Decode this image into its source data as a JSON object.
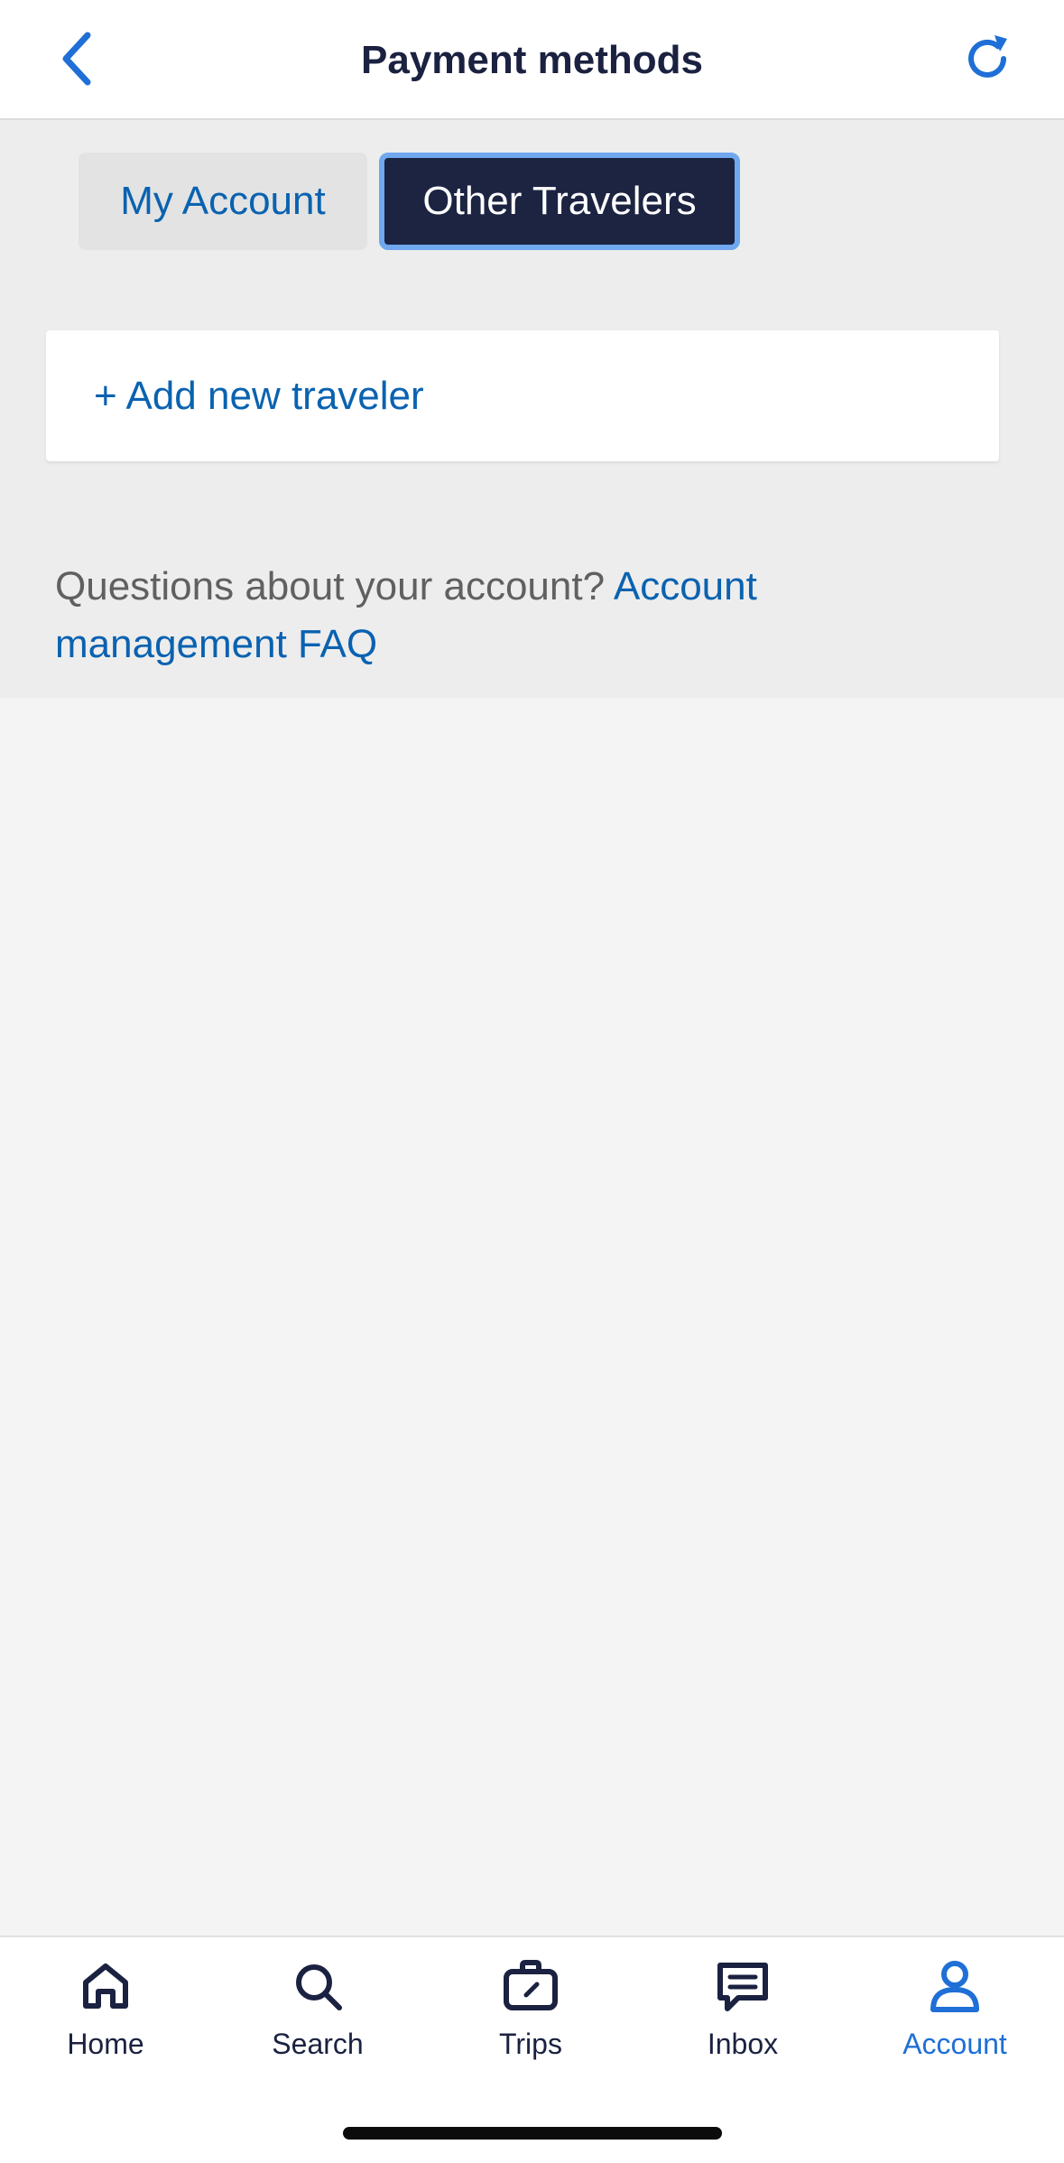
{
  "header": {
    "title": "Payment methods",
    "back_icon": "chevron-left-icon",
    "refresh_icon": "refresh-icon"
  },
  "tabs": [
    {
      "label": "My Account",
      "selected": false
    },
    {
      "label": "Other Travelers",
      "selected": true
    }
  ],
  "travelers": {
    "add_label": "+ Add new traveler"
  },
  "faq": {
    "prefix": "Questions about your account?",
    "link_label": "Account management FAQ"
  },
  "bottom_nav": {
    "items": [
      {
        "label": "Home",
        "icon": "home-icon"
      },
      {
        "label": "Search",
        "icon": "search-icon"
      },
      {
        "label": "Trips",
        "icon": "suitcase-icon"
      },
      {
        "label": "Inbox",
        "icon": "message-icon"
      },
      {
        "label": "Account",
        "icon": "person-icon",
        "active": true
      }
    ]
  },
  "colors": {
    "accent": "#1f6fd6",
    "link": "#0a62b0",
    "dark_navy": "#1c2442",
    "selected_tab_border": "#6fa8ee"
  }
}
